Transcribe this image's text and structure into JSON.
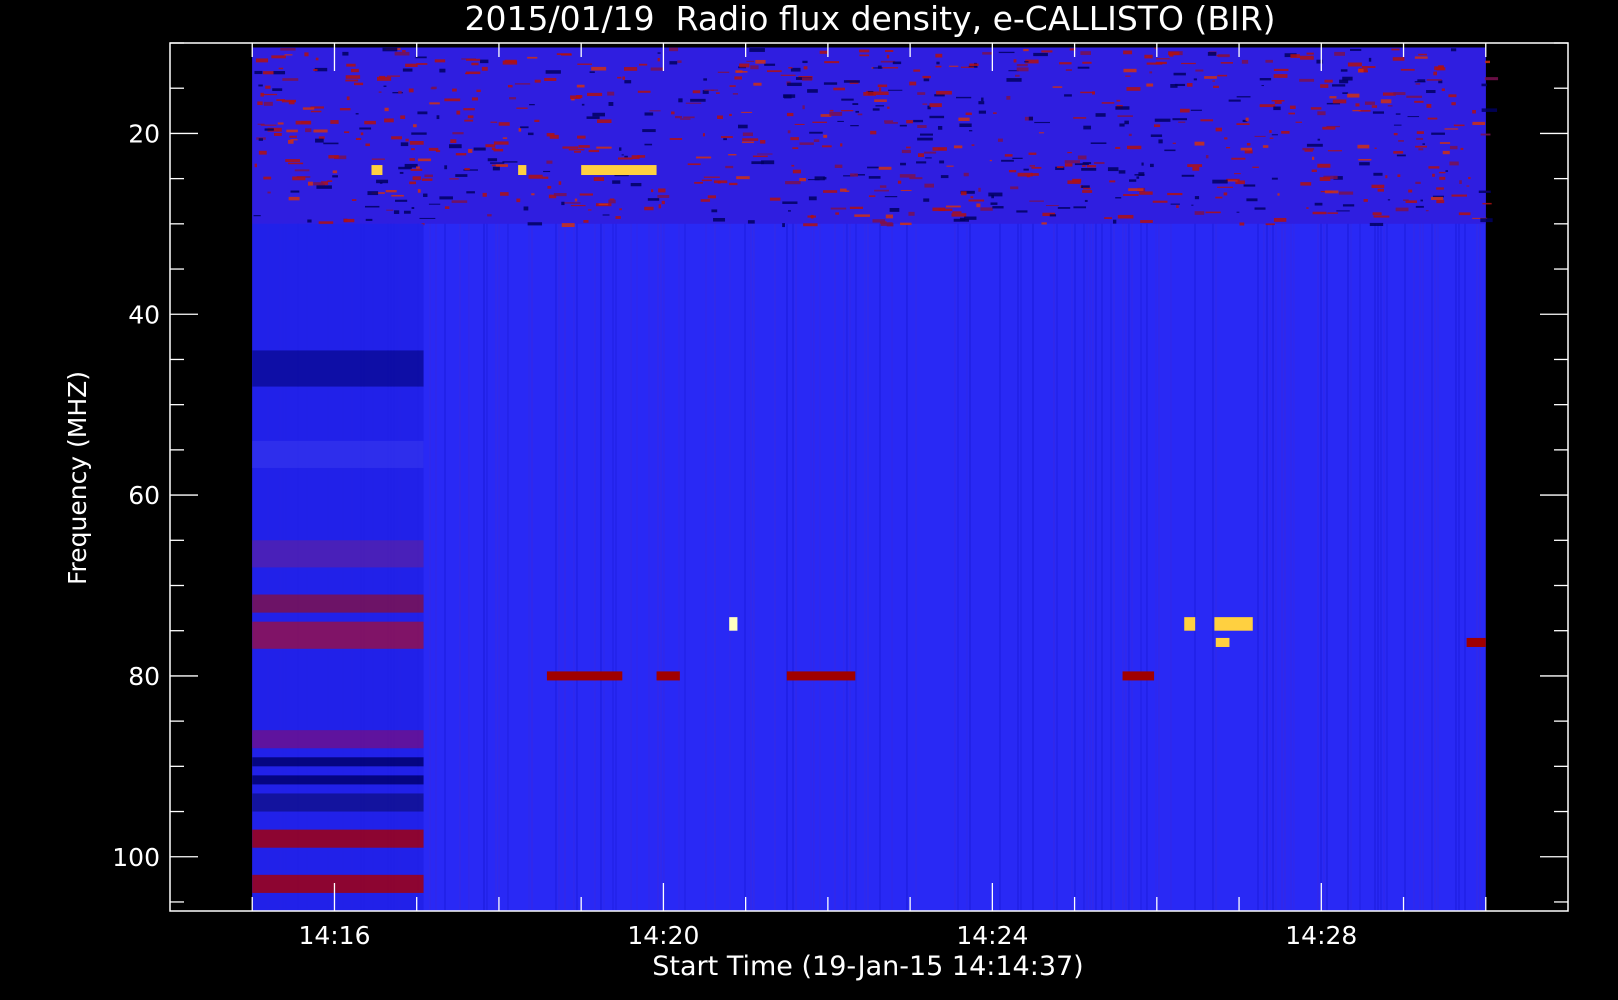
{
  "chart_data": {
    "type": "heatmap",
    "title": "2015/01/19  Radio flux density, e-CALLISTO (BIR)",
    "xlabel": "Start Time (19-Jan-15 14:14:37)",
    "ylabel": "Frequency (MHZ)",
    "x_range": [
      "14:14:37",
      "14:30:30"
    ],
    "xlim": [
      "14:14:00",
      "14:31:00"
    ],
    "ylim": [
      106,
      10
    ],
    "data_x_range": [
      "14:15:00",
      "14:30:00"
    ],
    "data_y_range": [
      10.5,
      106
    ],
    "x_ticks": [
      "14:16",
      "14:20",
      "14:24",
      "14:28"
    ],
    "y_ticks": [
      20,
      40,
      60,
      80,
      100
    ],
    "y_minor_step": 5,
    "x_minor_step_minutes": 1,
    "colors": {
      "background": "#2929f5",
      "low": "#00006a",
      "mid": "#a00000",
      "high": "#ffd040",
      "peak": "#ffffc0",
      "axis": "#ffffff",
      "page": "#000000"
    },
    "features": [
      {
        "kind": "band",
        "label": "interference band",
        "freq": [
          10.5,
          30
        ],
        "time": [
          "14:15:00",
          "14:30:00"
        ],
        "intensity": "mid"
      },
      {
        "kind": "band",
        "label": "receiver startup strip",
        "freq": [
          30,
          106
        ],
        "time": [
          "14:15:00",
          "14:17:05"
        ],
        "intensity": "low"
      },
      {
        "kind": "burst",
        "freq": [
          23.5,
          24.6
        ],
        "time": [
          "14:19:00",
          "14:19:55"
        ],
        "intensity": "high"
      },
      {
        "kind": "burst",
        "freq": [
          23.5,
          24.6
        ],
        "time": [
          "14:18:14",
          "14:18:20"
        ],
        "intensity": "high"
      },
      {
        "kind": "burst",
        "freq": [
          23.5,
          24.6
        ],
        "time": [
          "14:16:27",
          "14:16:35"
        ],
        "intensity": "high"
      },
      {
        "kind": "burst",
        "freq": [
          73.5,
          75
        ],
        "time": [
          "14:20:48",
          "14:20:54"
        ],
        "intensity": "peak"
      },
      {
        "kind": "burst",
        "freq": [
          79.5,
          80.5
        ],
        "time": [
          "14:18:35",
          "14:19:30"
        ],
        "intensity": "mid"
      },
      {
        "kind": "burst",
        "freq": [
          79.5,
          80.5
        ],
        "time": [
          "14:19:55",
          "14:20:12"
        ],
        "intensity": "mid"
      },
      {
        "kind": "burst",
        "freq": [
          79.5,
          80.5
        ],
        "time": [
          "14:21:30",
          "14:22:20"
        ],
        "intensity": "mid"
      },
      {
        "kind": "burst",
        "freq": [
          79.5,
          80.5
        ],
        "time": [
          "14:25:35",
          "14:25:58"
        ],
        "intensity": "mid"
      },
      {
        "kind": "burst",
        "freq": [
          73.5,
          75
        ],
        "time": [
          "14:26:20",
          "14:26:28"
        ],
        "intensity": "high"
      },
      {
        "kind": "burst",
        "freq": [
          73.5,
          75
        ],
        "time": [
          "14:26:42",
          "14:27:10"
        ],
        "intensity": "high"
      },
      {
        "kind": "burst",
        "freq": [
          75.8,
          76.8
        ],
        "time": [
          "14:26:43",
          "14:26:53"
        ],
        "intensity": "high"
      },
      {
        "kind": "burst",
        "freq": [
          75.8,
          76.8
        ],
        "time": [
          "14:29:46",
          "14:30:00"
        ],
        "intensity": "mid"
      }
    ]
  }
}
